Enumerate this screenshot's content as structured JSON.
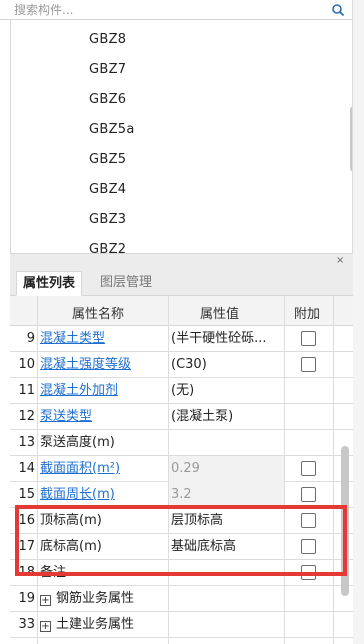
{
  "search": {
    "placeholder": "搜索构件...",
    "icon": "search-icon"
  },
  "component_list": {
    "items": [
      {
        "label": "GBZ8"
      },
      {
        "label": "GBZ7"
      },
      {
        "label": "GBZ6"
      },
      {
        "label": "GBZ5a"
      },
      {
        "label": "GBZ5"
      },
      {
        "label": "GBZ4"
      },
      {
        "label": "GBZ3"
      },
      {
        "label": "GBZ2"
      }
    ]
  },
  "panel": {
    "close_label": "×"
  },
  "tabs": {
    "properties": "属性列表",
    "layers": "图层管理"
  },
  "table": {
    "headers": {
      "name": "属性名称",
      "value": "属性值",
      "extra": "附加"
    },
    "rows": [
      {
        "num": "9",
        "name": "混凝土类型",
        "value": "(半干硬性砼砾...",
        "link": true,
        "checkbox": true
      },
      {
        "num": "10",
        "name": "混凝土强度等级",
        "value": "(C30)",
        "link": true,
        "checkbox": true
      },
      {
        "num": "11",
        "name": "混凝土外加剂",
        "value": "(无)",
        "link": true,
        "checkbox": false
      },
      {
        "num": "12",
        "name": "泵送类型",
        "value": "(混凝土泵)",
        "link": true,
        "checkbox": false
      },
      {
        "num": "13",
        "name": "泵送高度(m)",
        "value": "",
        "link": false,
        "checkbox": false
      },
      {
        "num": "14",
        "name": "截面面积(m²)",
        "value": "0.29",
        "link": true,
        "checkbox": true,
        "grey": true
      },
      {
        "num": "15",
        "name": "截面周长(m)",
        "value": "3.2",
        "link": true,
        "checkbox": true,
        "grey": true
      },
      {
        "num": "16",
        "name": "顶标高(m)",
        "value": "层顶标高",
        "link": false,
        "checkbox": true
      },
      {
        "num": "17",
        "name": "底标高(m)",
        "value": "基础底标高",
        "link": false,
        "checkbox": true
      },
      {
        "num": "18",
        "name": "备注",
        "value": "",
        "link": false,
        "checkbox": true
      },
      {
        "num": "19",
        "name": "钢筋业务属性",
        "value": "",
        "link": false,
        "checkbox": false,
        "group": true
      },
      {
        "num": "33",
        "name": "土建业务属性",
        "value": "",
        "link": false,
        "checkbox": false,
        "group": true
      }
    ]
  },
  "colors": {
    "link": "#1f6fd1",
    "highlight": "#e53935"
  }
}
